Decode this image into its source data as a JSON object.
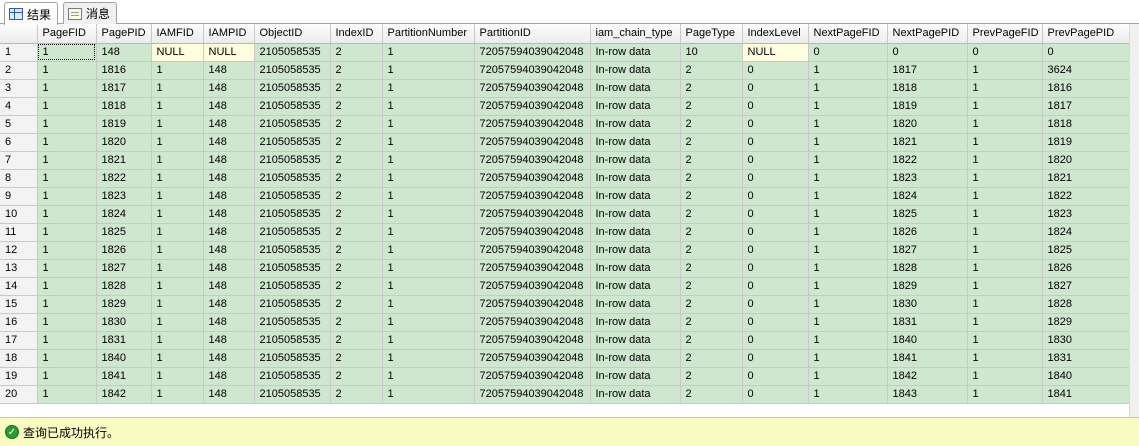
{
  "tabs": [
    {
      "label": "结果",
      "icon": "grid-icon",
      "active": true
    },
    {
      "label": "消息",
      "icon": "message-icon",
      "active": false
    }
  ],
  "columns": [
    "",
    "PageFID",
    "PagePID",
    "IAMFID",
    "IAMPID",
    "ObjectID",
    "IndexID",
    "PartitionNumber",
    "PartitionID",
    "iam_chain_type",
    "PageType",
    "IndexLevel",
    "NextPageFID",
    "NextPagePID",
    "PrevPageFID",
    "PrevPagePID"
  ],
  "rows": [
    [
      "1",
      "1",
      "148",
      "NULL",
      "NULL",
      "2105058535",
      "2",
      "1",
      "72057594039042048",
      "In-row data",
      "10",
      "NULL",
      "0",
      "0",
      "0",
      "0"
    ],
    [
      "2",
      "1",
      "1816",
      "1",
      "148",
      "2105058535",
      "2",
      "1",
      "72057594039042048",
      "In-row data",
      "2",
      "0",
      "1",
      "1817",
      "1",
      "3624"
    ],
    [
      "3",
      "1",
      "1817",
      "1",
      "148",
      "2105058535",
      "2",
      "1",
      "72057594039042048",
      "In-row data",
      "2",
      "0",
      "1",
      "1818",
      "1",
      "1816"
    ],
    [
      "4",
      "1",
      "1818",
      "1",
      "148",
      "2105058535",
      "2",
      "1",
      "72057594039042048",
      "In-row data",
      "2",
      "0",
      "1",
      "1819",
      "1",
      "1817"
    ],
    [
      "5",
      "1",
      "1819",
      "1",
      "148",
      "2105058535",
      "2",
      "1",
      "72057594039042048",
      "In-row data",
      "2",
      "0",
      "1",
      "1820",
      "1",
      "1818"
    ],
    [
      "6",
      "1",
      "1820",
      "1",
      "148",
      "2105058535",
      "2",
      "1",
      "72057594039042048",
      "In-row data",
      "2",
      "0",
      "1",
      "1821",
      "1",
      "1819"
    ],
    [
      "7",
      "1",
      "1821",
      "1",
      "148",
      "2105058535",
      "2",
      "1",
      "72057594039042048",
      "In-row data",
      "2",
      "0",
      "1",
      "1822",
      "1",
      "1820"
    ],
    [
      "8",
      "1",
      "1822",
      "1",
      "148",
      "2105058535",
      "2",
      "1",
      "72057594039042048",
      "In-row data",
      "2",
      "0",
      "1",
      "1823",
      "1",
      "1821"
    ],
    [
      "9",
      "1",
      "1823",
      "1",
      "148",
      "2105058535",
      "2",
      "1",
      "72057594039042048",
      "In-row data",
      "2",
      "0",
      "1",
      "1824",
      "1",
      "1822"
    ],
    [
      "10",
      "1",
      "1824",
      "1",
      "148",
      "2105058535",
      "2",
      "1",
      "72057594039042048",
      "In-row data",
      "2",
      "0",
      "1",
      "1825",
      "1",
      "1823"
    ],
    [
      "11",
      "1",
      "1825",
      "1",
      "148",
      "2105058535",
      "2",
      "1",
      "72057594039042048",
      "In-row data",
      "2",
      "0",
      "1",
      "1826",
      "1",
      "1824"
    ],
    [
      "12",
      "1",
      "1826",
      "1",
      "148",
      "2105058535",
      "2",
      "1",
      "72057594039042048",
      "In-row data",
      "2",
      "0",
      "1",
      "1827",
      "1",
      "1825"
    ],
    [
      "13",
      "1",
      "1827",
      "1",
      "148",
      "2105058535",
      "2",
      "1",
      "72057594039042048",
      "In-row data",
      "2",
      "0",
      "1",
      "1828",
      "1",
      "1826"
    ],
    [
      "14",
      "1",
      "1828",
      "1",
      "148",
      "2105058535",
      "2",
      "1",
      "72057594039042048",
      "In-row data",
      "2",
      "0",
      "1",
      "1829",
      "1",
      "1827"
    ],
    [
      "15",
      "1",
      "1829",
      "1",
      "148",
      "2105058535",
      "2",
      "1",
      "72057594039042048",
      "In-row data",
      "2",
      "0",
      "1",
      "1830",
      "1",
      "1828"
    ],
    [
      "16",
      "1",
      "1830",
      "1",
      "148",
      "2105058535",
      "2",
      "1",
      "72057594039042048",
      "In-row data",
      "2",
      "0",
      "1",
      "1831",
      "1",
      "1829"
    ],
    [
      "17",
      "1",
      "1831",
      "1",
      "148",
      "2105058535",
      "2",
      "1",
      "72057594039042048",
      "In-row data",
      "2",
      "0",
      "1",
      "1840",
      "1",
      "1830"
    ],
    [
      "18",
      "1",
      "1840",
      "1",
      "148",
      "2105058535",
      "2",
      "1",
      "72057594039042048",
      "In-row data",
      "2",
      "0",
      "1",
      "1841",
      "1",
      "1831"
    ],
    [
      "19",
      "1",
      "1841",
      "1",
      "148",
      "2105058535",
      "2",
      "1",
      "72057594039042048",
      "In-row data",
      "2",
      "0",
      "1",
      "1842",
      "1",
      "1840"
    ],
    [
      "20",
      "1",
      "1842",
      "1",
      "148",
      "2105058535",
      "2",
      "1",
      "72057594039042048",
      "In-row data",
      "2",
      "0",
      "1",
      "1843",
      "1",
      "1841"
    ]
  ],
  "status": {
    "text": "查询已成功执行。",
    "icon": "check-circle-icon"
  },
  "colors": {
    "cell_bg": "#cfe6cf",
    "null_bg": "#ffffe0",
    "status_bg": "#fafac3"
  }
}
